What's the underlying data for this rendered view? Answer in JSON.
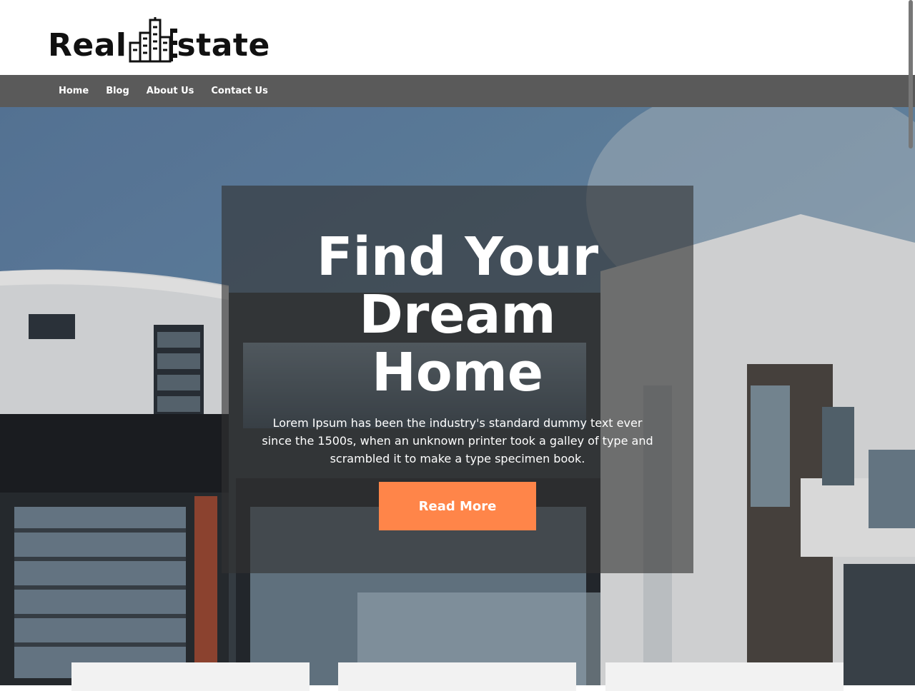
{
  "header": {
    "logo_left": "Real",
    "logo_right": "state",
    "logo_icon": "city-buildings-icon"
  },
  "nav": {
    "items": [
      {
        "label": "Home"
      },
      {
        "label": "Blog"
      },
      {
        "label": "About Us"
      },
      {
        "label": "Contact Us"
      }
    ]
  },
  "hero": {
    "title_line1": "Find Your",
    "title_line2": "Dream",
    "title_line3": "Home",
    "description": "Lorem Ipsum has been the industry's standard dummy text ever since the 1500s, when an unknown printer took a galley of type and scrambled it to make a type specimen book.",
    "button_label": "Read More"
  },
  "colors": {
    "accent": "#ff8549",
    "nav_bg": "#5a5a5a",
    "card_bg": "#f2f2f2"
  }
}
